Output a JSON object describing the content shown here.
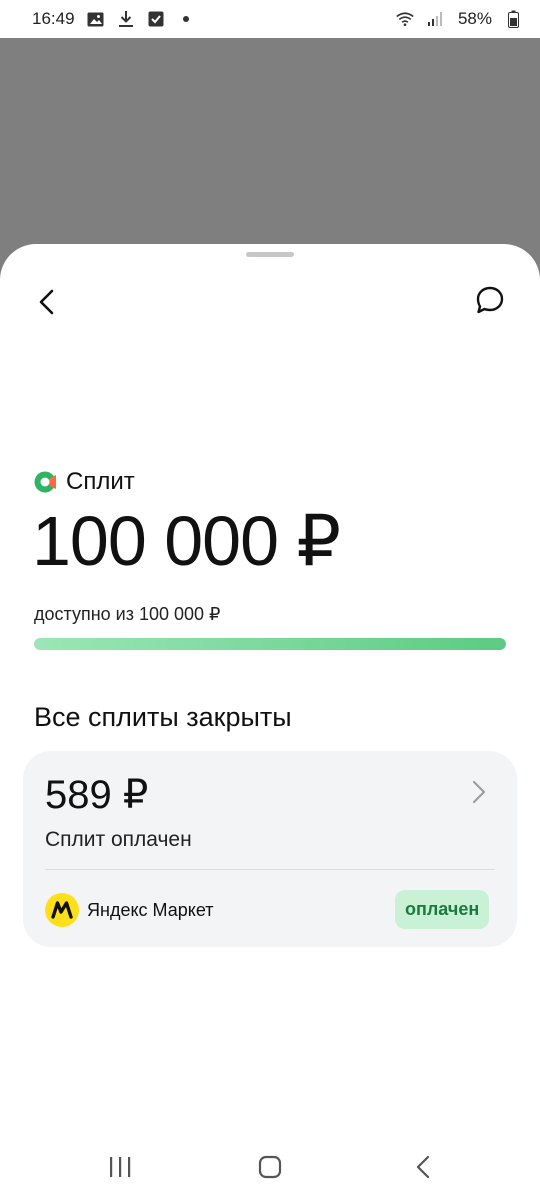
{
  "status_bar": {
    "time": "16:49",
    "battery": "58%"
  },
  "header": {
    "back_icon": "chevron-left-icon",
    "chat_icon": "chat-bubble-icon"
  },
  "summary": {
    "brand_name": "Сплит",
    "amount": "100 000 ₽",
    "available_text": "доступно из 100 000 ₽",
    "progress_fraction": 1.0
  },
  "splits": {
    "section_title": "Все сплиты закрыты",
    "items": [
      {
        "amount": "589 ₽",
        "status": "Сплит оплачен",
        "merchant": "Яндекс Маркет",
        "badge": "оплачен"
      }
    ]
  },
  "colors": {
    "accent_green": "#5ccb84",
    "badge_bg": "#c9f1d6",
    "badge_text": "#1b7a3d",
    "merchant_yellow": "#ffdf1a"
  }
}
